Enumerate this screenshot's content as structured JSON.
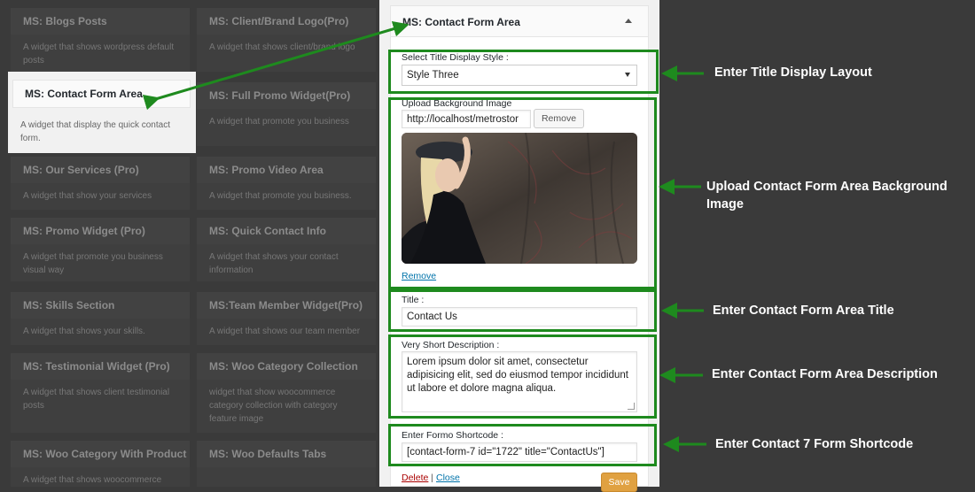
{
  "widgets": [
    {
      "title": "MS: Blogs Posts",
      "desc": "A widget that shows wordpress default posts"
    },
    {
      "title": "MS: Client/Brand Logo(Pro)",
      "desc": "A widget that shows client/brand logo"
    },
    {
      "title": "MS: Contact Form Area",
      "desc": "A widget that display the quick contact form."
    },
    {
      "title": "MS: Full Promo Widget(Pro)",
      "desc": "A widget that promote you business"
    },
    {
      "title": "MS: Our Services (Pro)",
      "desc": "A widget that show your services"
    },
    {
      "title": "MS: Promo Video Area",
      "desc": "A widget that promote you business."
    },
    {
      "title": "MS: Promo Widget (Pro)",
      "desc": "A widget that promote you business visual way"
    },
    {
      "title": "MS: Quick Contact Info",
      "desc": "A widget that shows your contact information"
    },
    {
      "title": "MS: Skills Section",
      "desc": "A widget that shows your skills."
    },
    {
      "title": "MS:Team Member Widget(Pro)",
      "desc": "A widget that shows our team member"
    },
    {
      "title": "MS: Testimonial Widget (Pro)",
      "desc": "A widget that shows client testimonial posts"
    },
    {
      "title": "MS: Woo Category Collection",
      "desc": "widget that show woocommerce category collection with category feature image"
    },
    {
      "title": "MS: Woo Category With Product",
      "desc": "A widget that shows woocommerce"
    },
    {
      "title": "MS: Woo Defaults Tabs",
      "desc": ""
    }
  ],
  "panel": {
    "title": "MS: Contact Form Area",
    "title_style_label": "Select Title Display Style :",
    "title_style_value": "Style Three",
    "bg_label": "Upload Background Image",
    "bg_url": "http://localhost/metrostor",
    "remove_button": "Remove",
    "remove_link": "Remove",
    "title_label": "Title :",
    "title_value": "Contact Us",
    "desc_label": "Very Short Description :",
    "desc_value": "Lorem ipsum dolor sit amet, consectetur adipisicing elit, sed do eiusmod tempor incididunt ut labore et dolore magna aliqua.",
    "shortcode_label": "Enter Formo Shortcode :",
    "shortcode_value": "[contact-form-7 id=\"1722\" title=\"ContactUs\"]",
    "delete_link": "Delete",
    "separator": "|",
    "close_link": "Close",
    "save_button": "Save"
  },
  "annotations": {
    "title_layout": "Enter Title Display Layout",
    "background": "Upload Contact Form Area Background Image",
    "title": "Enter Contact Form Area Title",
    "description": "Enter Contact Form Area Description",
    "shortcode": "Enter Contact 7 Form Shortcode"
  },
  "colors": {
    "highlight_green": "#1e8a1e",
    "save_orange": "#e0a141",
    "link_blue": "#0073aa",
    "delete_red": "#a00"
  }
}
